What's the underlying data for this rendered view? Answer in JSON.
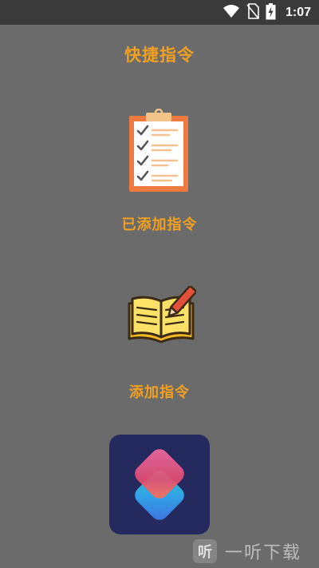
{
  "status_bar": {
    "time": "1:07",
    "icons": [
      "wifi-icon",
      "no-sim-icon",
      "battery-charging-icon"
    ]
  },
  "header": {
    "title": "快捷指令"
  },
  "menu": {
    "items": [
      {
        "label": "已添加指令",
        "icon": "clipboard-checklist-icon"
      },
      {
        "label": "添加指令",
        "icon": "open-book-pencil-icon"
      }
    ]
  },
  "shortcuts_app": {
    "icon": "shortcuts-app-icon"
  },
  "watermark": {
    "logo_text": "听",
    "text": "一听下载"
  },
  "colors": {
    "background": "#6b6b6b",
    "status_bar": "#3a3a3a",
    "accent": "#f3a020",
    "tile": "#252a5e"
  }
}
